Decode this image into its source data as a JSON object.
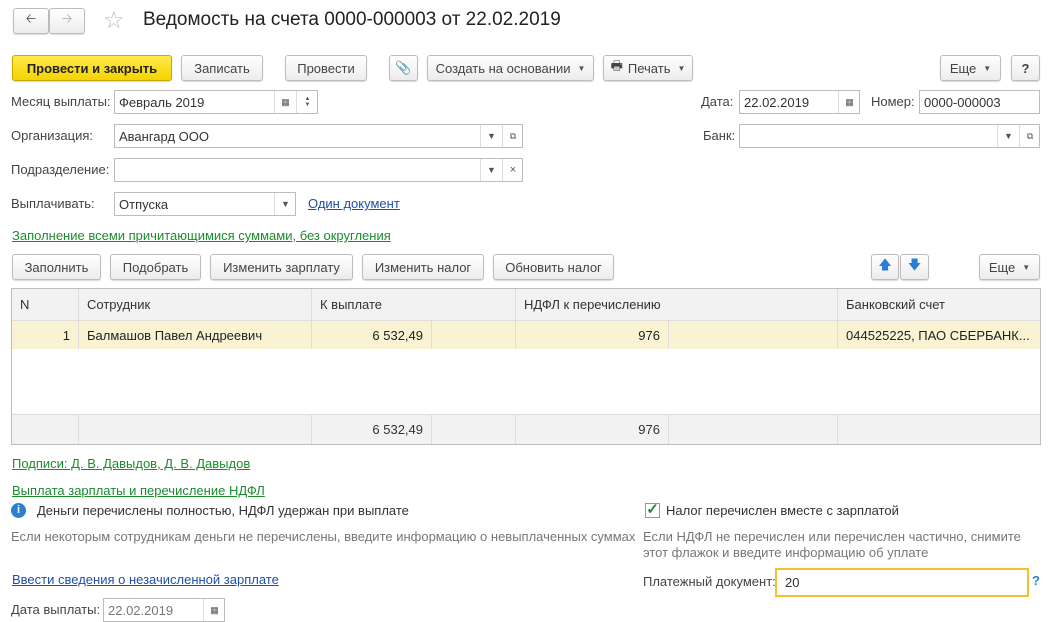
{
  "header": {
    "title": "Ведомость на счета 0000-000003 от 22.02.2019"
  },
  "toolbar": {
    "post_close": "Провести и закрыть",
    "save": "Записать",
    "post": "Провести",
    "create_based": "Создать на основании",
    "print": "Печать",
    "more": "Еще",
    "help": "?"
  },
  "form": {
    "month_label": "Месяц выплаты:",
    "month_value": "Февраль 2019",
    "date_label": "Дата:",
    "date_value": "22.02.2019",
    "number_label": "Номер:",
    "number_value": "0000-000003",
    "org_label": "Организация:",
    "org_value": "Авангард ООО",
    "bank_label": "Банк:",
    "bank_value": "",
    "dept_label": "Подразделение:",
    "dept_value": "",
    "pay_label": "Выплачивать:",
    "pay_value": "Отпуска",
    "one_doc_link": "Один документ",
    "fill_mode_link": "Заполнение всеми причитающимися суммами, без округления"
  },
  "table_toolbar": {
    "fill": "Заполнить",
    "pick": "Подобрать",
    "change_salary": "Изменить зарплату",
    "change_tax": "Изменить налог",
    "update_tax": "Обновить налог",
    "more": "Еще"
  },
  "table": {
    "columns": [
      "N",
      "Сотрудник",
      "К выплате",
      "НДФЛ к перечислению",
      "Банковский счет"
    ],
    "rows": [
      {
        "n": "1",
        "employee": "Балмашов Павел Андреевич",
        "to_pay": "6 532,49",
        "ndfl": "976",
        "account": "044525225, ПАО СБЕРБАНК..."
      }
    ],
    "totals": {
      "to_pay": "6 532,49",
      "ndfl": "976"
    }
  },
  "footer": {
    "signatures_link": "Подписи: Д. В. Давыдов, Д. В. Давыдов",
    "payment_link": "Выплата зарплаты и перечисление НДФЛ",
    "info_text": "Деньги перечислены  полностью, НДФЛ удержан при выплате",
    "hint_left": "Если некоторым сотрудникам деньги не перечислены, введите информацию о невыплаченных суммах",
    "tax_checkbox_label": "Налог перечислен вместе с зарплатой",
    "tax_checked": true,
    "hint_right_1": "Если НДФЛ не перечислен или перечислен частично, снимите",
    "hint_right_2": "этот флажок и введите информацию об уплате",
    "unpaid_link": "Ввести сведения о незачисленной зарплате",
    "paydoc_label": "Платежный документ:",
    "paydoc_value": "20",
    "paydoc_help": "?",
    "paydate_label": "Дата выплаты:",
    "paydate_value": "22.02.2019"
  }
}
